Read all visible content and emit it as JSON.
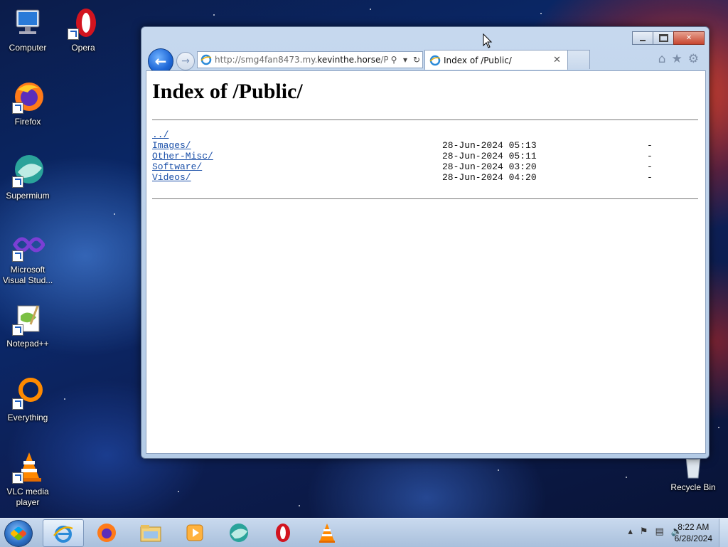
{
  "desktop": {
    "icons": [
      {
        "label": "Computer"
      },
      {
        "label": "Opera"
      },
      {
        "label": "Firefox"
      },
      {
        "label": "Supermium"
      },
      {
        "label": "Microsoft Visual Stud..."
      },
      {
        "label": "Notepad++"
      },
      {
        "label": "Everything"
      },
      {
        "label": "VLC media player"
      },
      {
        "label": "Recycle Bin"
      }
    ]
  },
  "browser": {
    "address_url": "http://smg4fan8473.my.",
    "address_domain": "kevinthe.horse",
    "address_path": "/Publ",
    "tab_title": "Index of /Public/",
    "page": {
      "heading": "Index of /Public/",
      "parent_link": "../",
      "entries": [
        {
          "name": "Images/",
          "date": "28-Jun-2024 05:13",
          "size": "-"
        },
        {
          "name": "Other-Misc/",
          "date": "28-Jun-2024 05:11",
          "size": "-"
        },
        {
          "name": "Software/",
          "date": "28-Jun-2024 03:20",
          "size": "-"
        },
        {
          "name": "Videos/",
          "date": "28-Jun-2024 04:20",
          "size": "-"
        }
      ]
    }
  },
  "taskbar": {
    "clock_time": "8:22 AM",
    "clock_date": "6/28/2024"
  },
  "colors": {
    "link": "#1a4fa8",
    "close_button": "#c74630"
  }
}
